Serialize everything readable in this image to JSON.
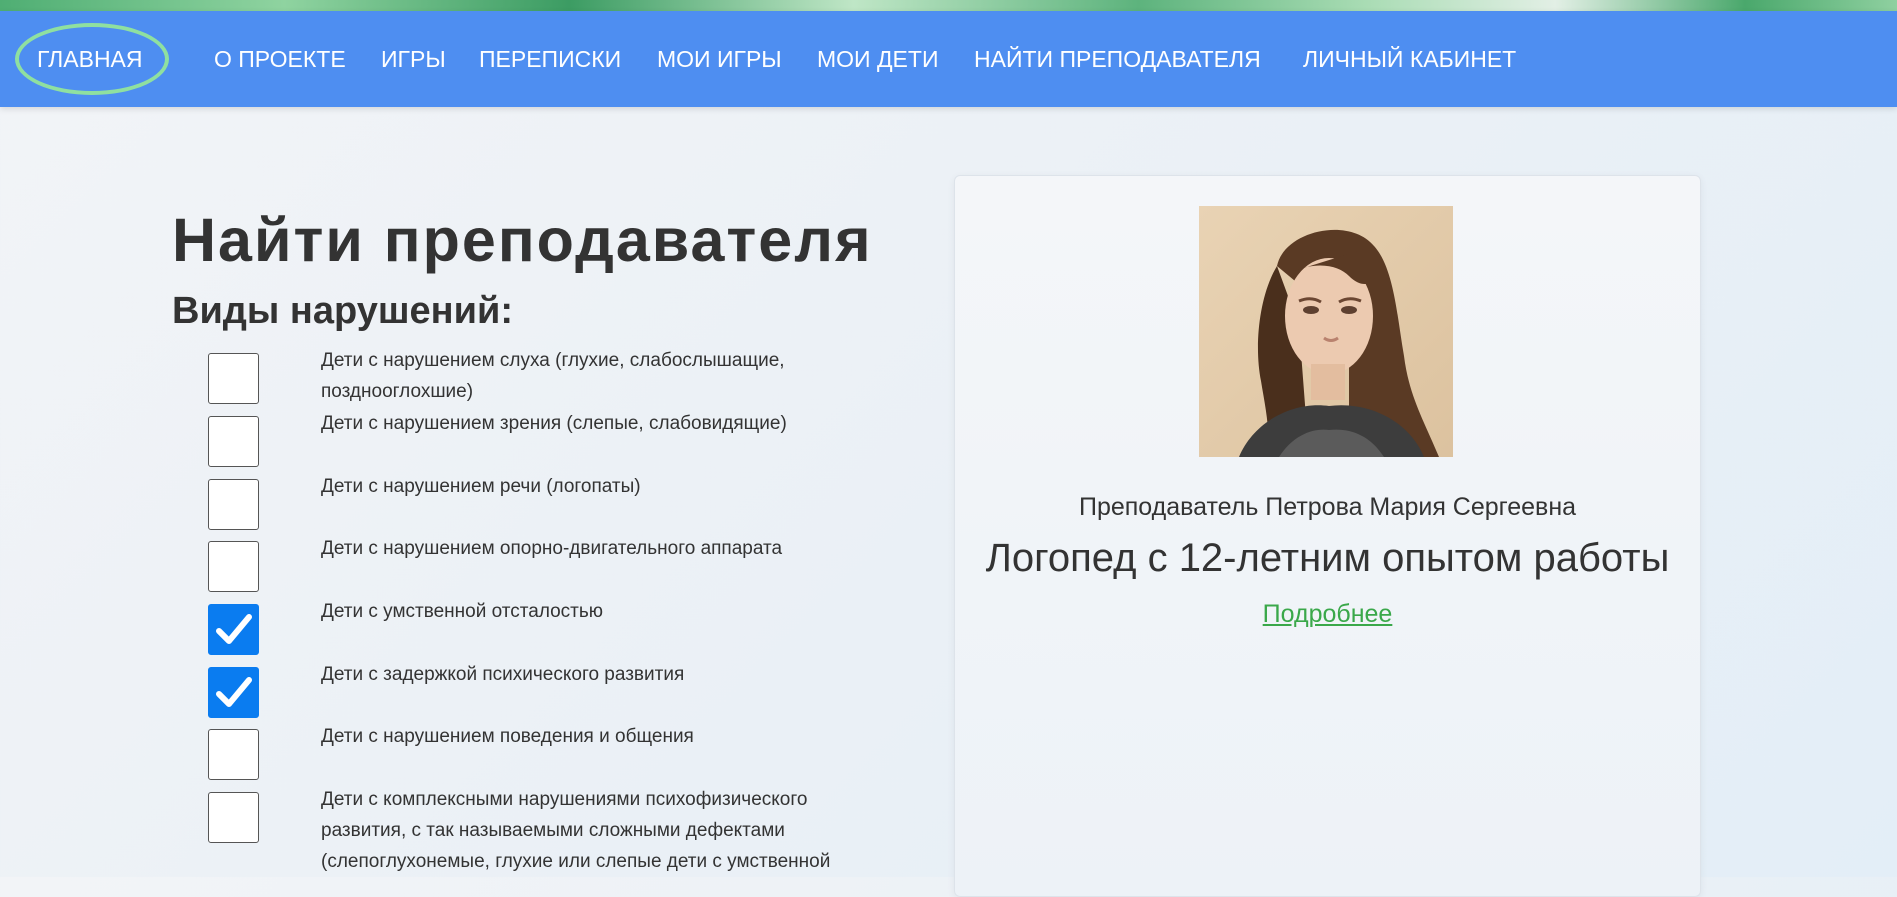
{
  "nav": {
    "items": [
      {
        "label": "ГЛАВНАЯ"
      },
      {
        "label": "О ПРОЕКТЕ"
      },
      {
        "label": "ИГРЫ"
      },
      {
        "label": "ПЕРЕПИСКИ"
      },
      {
        "label": "МОИ ИГРЫ"
      },
      {
        "label": "МОИ ДЕТИ"
      },
      {
        "label": "НАЙТИ ПРЕПОДАВАТЕЛЯ"
      },
      {
        "label": "ЛИЧНЫЙ КАБИНЕТ"
      }
    ],
    "highlighted": "ГЛАВНАЯ"
  },
  "page": {
    "title": "Найти преподавателя",
    "subtitle": "Виды нарушений:"
  },
  "filters": [
    {
      "label": "Дети с нарушением слуха (глухие, слабослышащие, позднооглохшие)",
      "checked": false
    },
    {
      "label": "Дети с нарушением зрения (слепые, слабовидящие)",
      "checked": false
    },
    {
      "label": "Дети с нарушением речи (логопаты)",
      "checked": false
    },
    {
      "label": "Дети с нарушением опорно-двигательного аппарата",
      "checked": false
    },
    {
      "label": "Дети с умственной отсталостью",
      "checked": true
    },
    {
      "label": "Дети с задержкой психического развития",
      "checked": true
    },
    {
      "label": "Дети с нарушением поведения и общения",
      "checked": false
    },
    {
      "label": "Дети с комплексными нарушениями психофизического развития, с так называемыми сложными дефектами (слепоглухонемые, глухие или слепые дети с умственной",
      "checked": false
    }
  ],
  "teacher_card": {
    "name": "Преподаватель Петрова Мария Сергеевна",
    "title": "Логопед с 12-летним опытом работы",
    "link_label": "Подробнее"
  },
  "colors": {
    "navbar": "#4e8ef1",
    "checkbox_checked": "#0a7cf0",
    "link": "#3aa84a",
    "home_ring": "#8fe0a0"
  }
}
